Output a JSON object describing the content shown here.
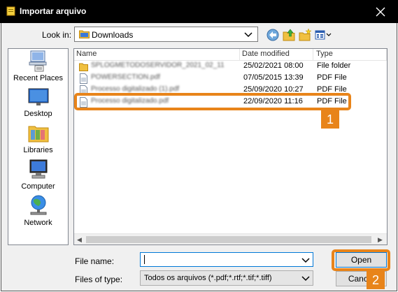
{
  "window": {
    "title": "Importar arquivo"
  },
  "toolbar": {
    "look_in_label": "Look in:",
    "look_in_value": "Downloads",
    "buttons": [
      "back-icon",
      "up-folder-icon",
      "new-folder-icon",
      "view-menu-icon"
    ]
  },
  "places": [
    {
      "label": "Recent Places",
      "icon": "recent-places-icon"
    },
    {
      "label": "Desktop",
      "icon": "desktop-icon"
    },
    {
      "label": "Libraries",
      "icon": "libraries-icon"
    },
    {
      "label": "Computer",
      "icon": "computer-icon"
    },
    {
      "label": "Network",
      "icon": "network-icon"
    }
  ],
  "file_list": {
    "columns": [
      "Name",
      "Date modified",
      "Type"
    ],
    "rows": [
      {
        "name": "SPLOGMETODOSERVIDOR_2021_02_11",
        "date": "25/02/2021 08:00",
        "type": "File folder",
        "icon": "folder-icon"
      },
      {
        "name": "POWERSECTION.pdf",
        "date": "07/05/2015 13:39",
        "type": "PDF File",
        "icon": "pdf-file-icon"
      },
      {
        "name": "Processo digitalizado (1).pdf",
        "date": "25/09/2020 10:27",
        "type": "PDF File",
        "icon": "pdf-file-icon"
      },
      {
        "name": "Processo digitalizado.pdf",
        "date": "22/09/2020 11:16",
        "type": "PDF File",
        "icon": "pdf-file-icon"
      }
    ]
  },
  "footer": {
    "file_name_label": "File name:",
    "file_name_value": "",
    "file_type_label": "Files of type:",
    "file_type_value": "Todos os arquivos (*.pdf;*.rtf;*.tif;*.tiff)",
    "open_label": "Open",
    "cancel_label": "Cancel"
  },
  "annotations": [
    "1",
    "2"
  ],
  "colors": {
    "accent": "#e8841a",
    "titlebar": "#000000",
    "focus": "#0078d7"
  }
}
